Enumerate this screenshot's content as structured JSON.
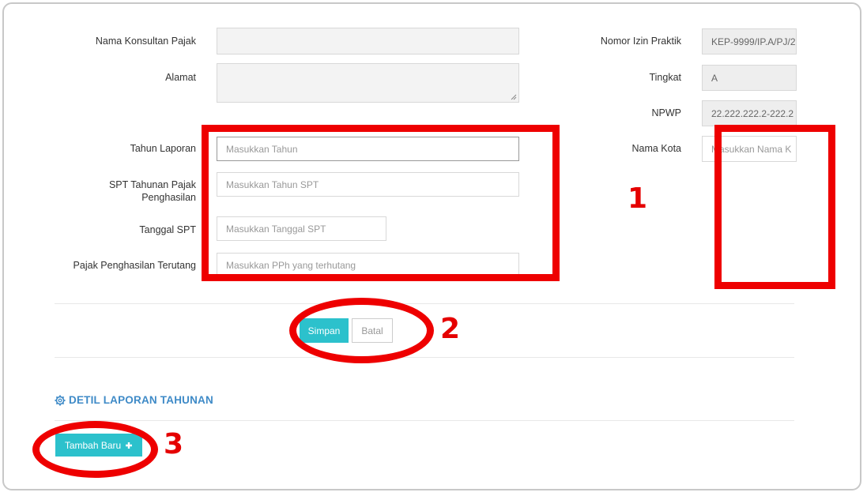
{
  "form": {
    "nama_konsultan_label": "Nama Konsultan Pajak",
    "alamat_label": "Alamat",
    "tahun_laporan_label": "Tahun Laporan",
    "tahun_laporan_placeholder": "Masukkan Tahun",
    "spt_tahunan_label_line1": "SPT Tahunan Pajak",
    "spt_tahunan_label_line2": "Penghasilan",
    "spt_tahunan_placeholder": "Masukkan Tahun SPT",
    "tanggal_spt_label": "Tanggal SPT",
    "tanggal_spt_placeholder": "Masukkan Tanggal SPT",
    "pph_terutang_label": "Pajak Penghasilan Terutang",
    "pph_terutang_placeholder": "Masukkan PPh yang terhutang",
    "nomor_izin_label": "Nomor Izin Praktik",
    "nomor_izin_value": "KEP-9999/IP.A/PJ/2",
    "tingkat_label": "Tingkat",
    "tingkat_value": "A",
    "npwp_label": "NPWP",
    "npwp_value": "22.222.222.2-222.2",
    "nama_kota_label": "Nama Kota",
    "nama_kota_placeholder": "Masukkan Nama K"
  },
  "actions": {
    "simpan_label": "Simpan",
    "batal_label": "Batal"
  },
  "detail_section": {
    "title": "DETIL LAPORAN TAHUNAN",
    "icon": "gear-icon",
    "tambah_baru_label": "Tambah Baru"
  },
  "annotations": {
    "color": "#ee0000",
    "label_1": "1",
    "label_2": "2",
    "label_3": "3"
  },
  "colors": {
    "primary_button": "#2cc1cc",
    "section_title": "#3e8ac7"
  }
}
